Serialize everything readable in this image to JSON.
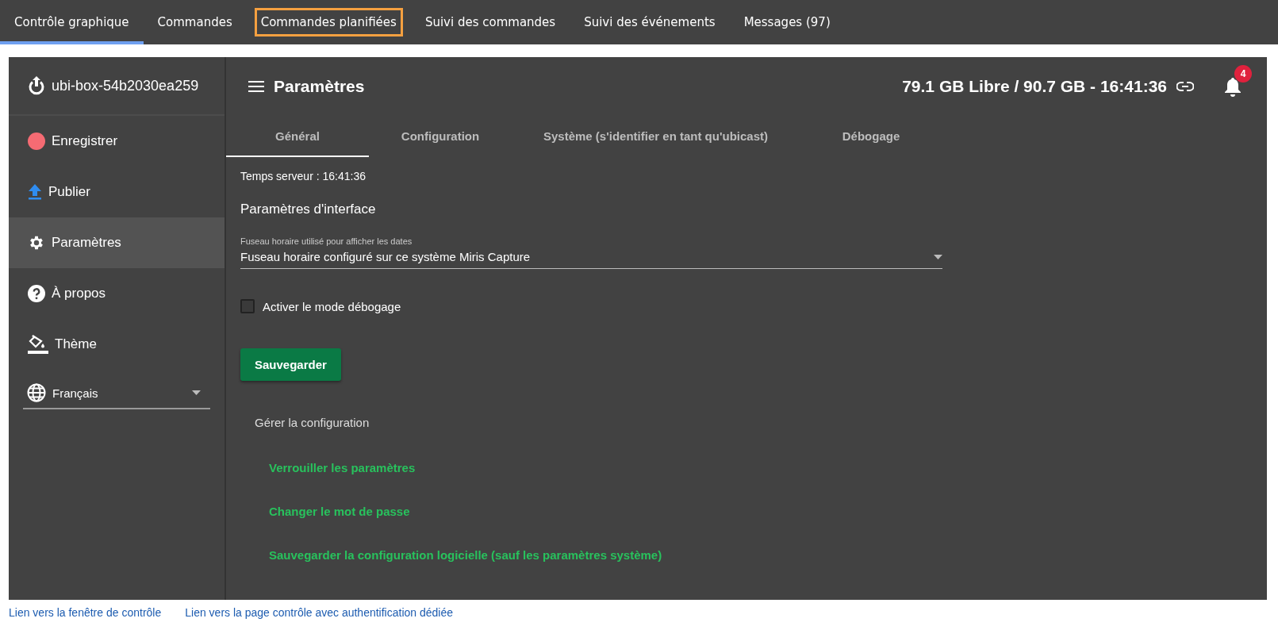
{
  "top_nav": {
    "tabs": [
      {
        "label": "Contrôle graphique",
        "selected": true,
        "highlighted": false
      },
      {
        "label": "Commandes",
        "selected": false,
        "highlighted": false
      },
      {
        "label": "Commandes planifiées",
        "selected": false,
        "highlighted": true
      },
      {
        "label": "Suivi des commandes",
        "selected": false,
        "highlighted": false
      },
      {
        "label": "Suivi des événements",
        "selected": false,
        "highlighted": false
      },
      {
        "label": "Messages (97)",
        "selected": false,
        "highlighted": false
      }
    ]
  },
  "sidebar": {
    "device_name": "ubi-box-54b2030ea259",
    "items": [
      {
        "kind": "record",
        "label": "Enregistrer",
        "selected": false
      },
      {
        "kind": "publish",
        "label": "Publier",
        "selected": false
      },
      {
        "kind": "settings",
        "label": "Paramètres",
        "selected": true
      },
      {
        "kind": "about",
        "label": "À propos",
        "selected": false
      },
      {
        "kind": "theme",
        "label": "Thème",
        "selected": false
      }
    ],
    "language": {
      "value": "Français"
    }
  },
  "header": {
    "title": "Paramètres",
    "status": "79.1 GB Libre / 90.7 GB - 16:41:36",
    "notification_count": "4"
  },
  "tabs": [
    {
      "label": "Général",
      "selected": true
    },
    {
      "label": "Configuration",
      "selected": false
    },
    {
      "label": "Système (s'identifier en tant qu'ubicast)",
      "selected": false
    },
    {
      "label": "Débogage",
      "selected": false
    }
  ],
  "general": {
    "server_time": "Temps serveur : 16:41:36",
    "section_title": "Paramètres d'interface",
    "timezone": {
      "label": "Fuseau horaire utilisé pour afficher les dates",
      "value": "Fuseau horaire configuré sur ce système Miris Capture"
    },
    "debug_checkbox": {
      "label": "Activer le mode débogage",
      "checked": false
    },
    "save_button": "Sauvegarder"
  },
  "configuration": {
    "title": "Gérer la configuration",
    "links": [
      "Verrouiller les paramètres",
      "Changer le mot de passe",
      "Sauvegarder la configuration logicielle (sauf les paramètres système)"
    ]
  },
  "footer_links": [
    "Lien vers la fenêtre de contrôle",
    "Lien vers la page contrôle avec authentification dédiée"
  ]
}
